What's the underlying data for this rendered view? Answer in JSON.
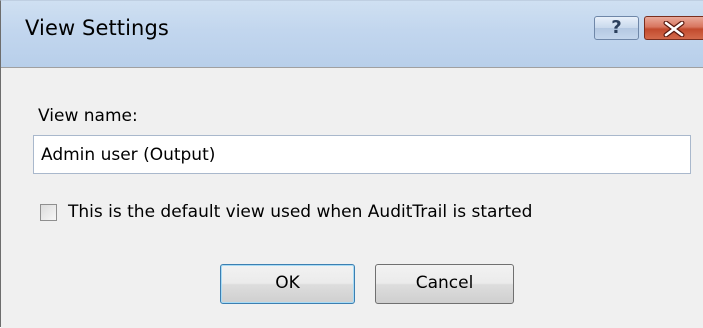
{
  "window": {
    "title": "View Settings",
    "help_label": "?",
    "close_label": "Close"
  },
  "form": {
    "view_name_label": "View name:",
    "view_name_value": "Admin user (Output)",
    "default_view_label": "This is the default view used when AuditTrail is started",
    "default_view_checked": false
  },
  "buttons": {
    "ok_label": "OK",
    "cancel_label": "Cancel"
  },
  "colors": {
    "titlebar": "#c2d6ee",
    "client_background": "#f0f0f0",
    "close_button": "#c24b2e",
    "ok_border": "#3c7fb1"
  },
  "icons": {
    "help": "question-mark-icon",
    "close": "close-x-icon"
  }
}
